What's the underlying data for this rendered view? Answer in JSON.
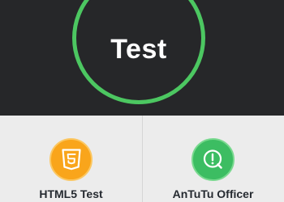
{
  "hero": {
    "button_label": "Test"
  },
  "tiles": [
    {
      "label": "HTML5 Test",
      "icon": "html5-icon"
    },
    {
      "label": "AnTuTu Officer",
      "icon": "antutu-officer-icon"
    }
  ],
  "colors": {
    "ring": "#4cc761",
    "html5": "#f9a51b",
    "antutu": "#3cbd62",
    "hero_bg": "#262729",
    "tile_bg": "#ececec"
  }
}
